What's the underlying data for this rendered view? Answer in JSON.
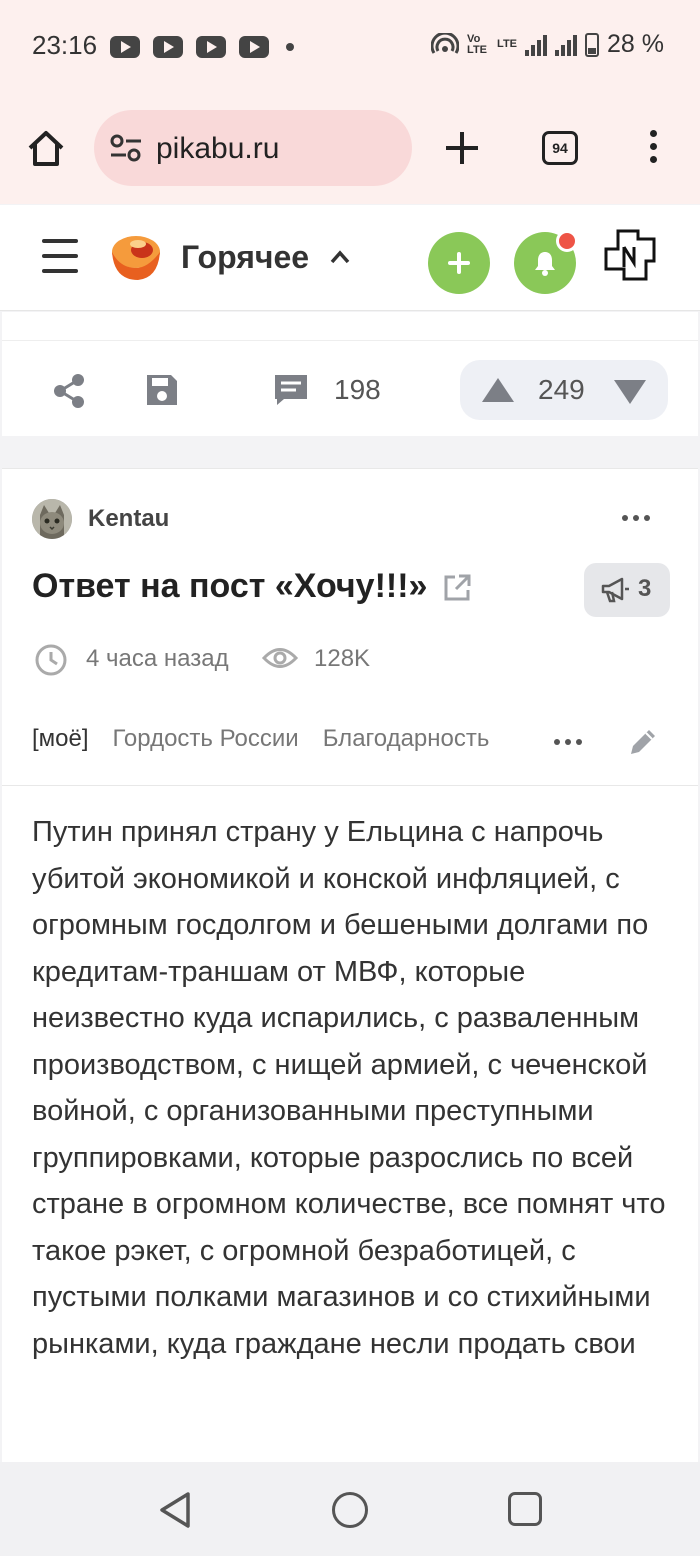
{
  "status_bar": {
    "time": "23:16",
    "volte_label": "Vo LTE",
    "lte_label": "LTE",
    "battery": "28 %"
  },
  "browser": {
    "url": "pikabu.ru",
    "tab_count": "94"
  },
  "header": {
    "section_title": "Горячее"
  },
  "prev_post": {
    "comments": "198",
    "rating": "249"
  },
  "post": {
    "author": "Kentau",
    "title": "Ответ на пост «Хочу!!!»",
    "comments_badge": "3",
    "time_ago": "4 часа назад",
    "views": "128K",
    "tags": [
      "[моё]",
      "Гордость России",
      "Благодарность"
    ],
    "text": "Путин принял страну у Ельцина с напрочь убитой экономикой и конской инфляцией, с огромным госдолгом и бешеными долгами по кредитам-траншам от МВФ, которые неизвестно куда испарились, с разваленным производством, с нищей армией, с чеченской войной, с организованными преступными группировками, которые разрослись по всей стране в огромном количестве, все помнят что такое рэкет, с огромной безработицей, с пустыми полками магазинов и со стихийными рынками, куда граждане несли продать свои"
  },
  "colors": {
    "accent_green": "#8ac858",
    "notification_red": "#ee5446",
    "chrome_bg": "#fdf0ee",
    "url_pill_bg": "#f9d9d9"
  }
}
